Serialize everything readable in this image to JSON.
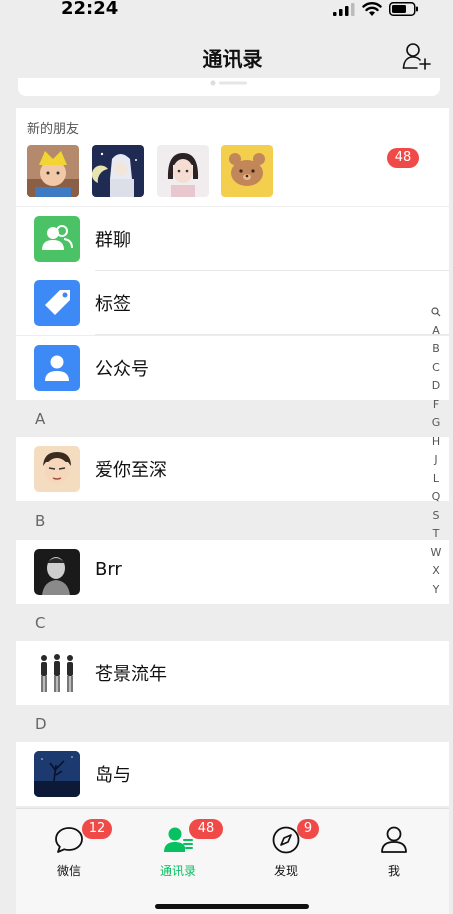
{
  "status": {
    "time": "22:24",
    "icons": [
      "signal-icon",
      "wifi-icon",
      "battery-icon"
    ]
  },
  "nav": {
    "title": "通讯录",
    "add_icon": "add-friend-icon"
  },
  "new_friends": {
    "label": "新的朋友",
    "badge": "48",
    "avatars": [
      "avatar-child-with-hat",
      "avatar-anime-boy",
      "avatar-girl",
      "avatar-bear-sticker"
    ]
  },
  "features": [
    {
      "label": "群聊",
      "icon": "group-chat-icon",
      "color": "#4cc267"
    },
    {
      "label": "标签",
      "icon": "tag-icon",
      "color": "#3d8af7"
    },
    {
      "label": "公众号",
      "icon": "official-account-icon",
      "color": "#3d8af7"
    }
  ],
  "sections": [
    {
      "letter": "A",
      "contacts": [
        "爱你至深"
      ]
    },
    {
      "letter": "B",
      "contacts": [
        "Brr"
      ]
    },
    {
      "letter": "C",
      "contacts": [
        "苍景流年"
      ]
    },
    {
      "letter": "D",
      "contacts": [
        "岛与"
      ]
    }
  ],
  "index_letters": [
    "A",
    "B",
    "C",
    "D",
    "F",
    "G",
    "H",
    "J",
    "L",
    "Q",
    "S",
    "T",
    "W",
    "X",
    "Y"
  ],
  "tabs": [
    {
      "label": "微信",
      "badge": "12",
      "icon": "chat-bubble-icon",
      "active": false
    },
    {
      "label": "通讯录",
      "badge": "48",
      "icon": "contacts-icon",
      "active": true
    },
    {
      "label": "发现",
      "badge": "9",
      "icon": "compass-icon",
      "active": false
    },
    {
      "label": "我",
      "badge": "",
      "icon": "person-icon",
      "active": false
    }
  ],
  "colors": {
    "accent": "#07c160",
    "badge": "#f04a48",
    "background": "#ededed"
  }
}
